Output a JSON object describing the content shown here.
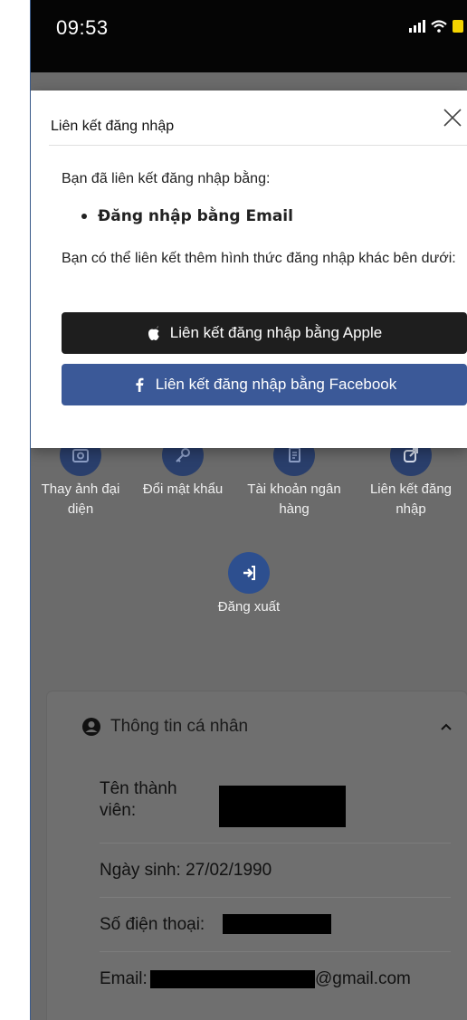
{
  "status_bar": {
    "time": "09:53",
    "battery_color": "#f5d400"
  },
  "modal": {
    "title": "Liên kết đăng nhập",
    "intro": "Bạn đã liên kết đăng nhập bằng:",
    "linked_methods": [
      "Đăng nhập bằng Email"
    ],
    "more_text": "Bạn có thể liên kết thêm hình thức đăng nhập khác bên dưới:",
    "apple_button_label": "Liên kết đăng nhập bằng Apple",
    "facebook_button_label": "Liên kết đăng nhập bằng Facebook",
    "apple_color": "#1e1e1e",
    "facebook_color": "#3b5998"
  },
  "actions": [
    {
      "label": "Thay ảnh đại diện",
      "icon": "camera-icon"
    },
    {
      "label": "Đổi mật khẩu",
      "icon": "key-icon"
    },
    {
      "label": "Tài khoản ngân hàng",
      "icon": "document-icon"
    },
    {
      "label": "Liên kết đăng nhập",
      "icon": "share-icon"
    },
    {
      "label": "Đăng xuất",
      "icon": "logout-icon"
    }
  ],
  "personal_info": {
    "title": "Thông tin cá nhân",
    "member_name_label": "Tên thành viên:",
    "birthday_label": "Ngày sinh:",
    "birthday_value": "27/02/1990",
    "phone_label": "Số điện thoại:",
    "email_label": "Email:",
    "email_visible_suffix": "@gmail.com"
  }
}
